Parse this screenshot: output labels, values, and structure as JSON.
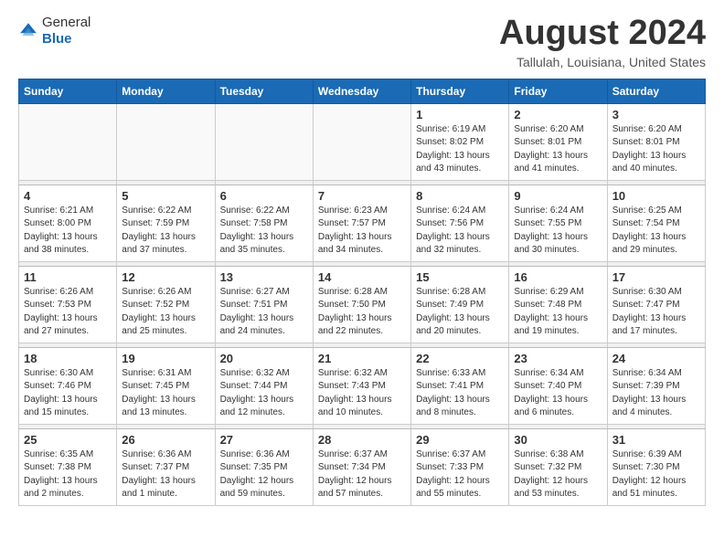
{
  "logo": {
    "general": "General",
    "blue": "Blue"
  },
  "title": "August 2024",
  "location": "Tallulah, Louisiana, United States",
  "weekdays": [
    "Sunday",
    "Monday",
    "Tuesday",
    "Wednesday",
    "Thursday",
    "Friday",
    "Saturday"
  ],
  "weeks": [
    [
      {
        "day": "",
        "info": ""
      },
      {
        "day": "",
        "info": ""
      },
      {
        "day": "",
        "info": ""
      },
      {
        "day": "",
        "info": ""
      },
      {
        "day": "1",
        "info": "Sunrise: 6:19 AM\nSunset: 8:02 PM\nDaylight: 13 hours\nand 43 minutes."
      },
      {
        "day": "2",
        "info": "Sunrise: 6:20 AM\nSunset: 8:01 PM\nDaylight: 13 hours\nand 41 minutes."
      },
      {
        "day": "3",
        "info": "Sunrise: 6:20 AM\nSunset: 8:01 PM\nDaylight: 13 hours\nand 40 minutes."
      }
    ],
    [
      {
        "day": "4",
        "info": "Sunrise: 6:21 AM\nSunset: 8:00 PM\nDaylight: 13 hours\nand 38 minutes."
      },
      {
        "day": "5",
        "info": "Sunrise: 6:22 AM\nSunset: 7:59 PM\nDaylight: 13 hours\nand 37 minutes."
      },
      {
        "day": "6",
        "info": "Sunrise: 6:22 AM\nSunset: 7:58 PM\nDaylight: 13 hours\nand 35 minutes."
      },
      {
        "day": "7",
        "info": "Sunrise: 6:23 AM\nSunset: 7:57 PM\nDaylight: 13 hours\nand 34 minutes."
      },
      {
        "day": "8",
        "info": "Sunrise: 6:24 AM\nSunset: 7:56 PM\nDaylight: 13 hours\nand 32 minutes."
      },
      {
        "day": "9",
        "info": "Sunrise: 6:24 AM\nSunset: 7:55 PM\nDaylight: 13 hours\nand 30 minutes."
      },
      {
        "day": "10",
        "info": "Sunrise: 6:25 AM\nSunset: 7:54 PM\nDaylight: 13 hours\nand 29 minutes."
      }
    ],
    [
      {
        "day": "11",
        "info": "Sunrise: 6:26 AM\nSunset: 7:53 PM\nDaylight: 13 hours\nand 27 minutes."
      },
      {
        "day": "12",
        "info": "Sunrise: 6:26 AM\nSunset: 7:52 PM\nDaylight: 13 hours\nand 25 minutes."
      },
      {
        "day": "13",
        "info": "Sunrise: 6:27 AM\nSunset: 7:51 PM\nDaylight: 13 hours\nand 24 minutes."
      },
      {
        "day": "14",
        "info": "Sunrise: 6:28 AM\nSunset: 7:50 PM\nDaylight: 13 hours\nand 22 minutes."
      },
      {
        "day": "15",
        "info": "Sunrise: 6:28 AM\nSunset: 7:49 PM\nDaylight: 13 hours\nand 20 minutes."
      },
      {
        "day": "16",
        "info": "Sunrise: 6:29 AM\nSunset: 7:48 PM\nDaylight: 13 hours\nand 19 minutes."
      },
      {
        "day": "17",
        "info": "Sunrise: 6:30 AM\nSunset: 7:47 PM\nDaylight: 13 hours\nand 17 minutes."
      }
    ],
    [
      {
        "day": "18",
        "info": "Sunrise: 6:30 AM\nSunset: 7:46 PM\nDaylight: 13 hours\nand 15 minutes."
      },
      {
        "day": "19",
        "info": "Sunrise: 6:31 AM\nSunset: 7:45 PM\nDaylight: 13 hours\nand 13 minutes."
      },
      {
        "day": "20",
        "info": "Sunrise: 6:32 AM\nSunset: 7:44 PM\nDaylight: 13 hours\nand 12 minutes."
      },
      {
        "day": "21",
        "info": "Sunrise: 6:32 AM\nSunset: 7:43 PM\nDaylight: 13 hours\nand 10 minutes."
      },
      {
        "day": "22",
        "info": "Sunrise: 6:33 AM\nSunset: 7:41 PM\nDaylight: 13 hours\nand 8 minutes."
      },
      {
        "day": "23",
        "info": "Sunrise: 6:34 AM\nSunset: 7:40 PM\nDaylight: 13 hours\nand 6 minutes."
      },
      {
        "day": "24",
        "info": "Sunrise: 6:34 AM\nSunset: 7:39 PM\nDaylight: 13 hours\nand 4 minutes."
      }
    ],
    [
      {
        "day": "25",
        "info": "Sunrise: 6:35 AM\nSunset: 7:38 PM\nDaylight: 13 hours\nand 2 minutes."
      },
      {
        "day": "26",
        "info": "Sunrise: 6:36 AM\nSunset: 7:37 PM\nDaylight: 13 hours\nand 1 minute."
      },
      {
        "day": "27",
        "info": "Sunrise: 6:36 AM\nSunset: 7:35 PM\nDaylight: 12 hours\nand 59 minutes."
      },
      {
        "day": "28",
        "info": "Sunrise: 6:37 AM\nSunset: 7:34 PM\nDaylight: 12 hours\nand 57 minutes."
      },
      {
        "day": "29",
        "info": "Sunrise: 6:37 AM\nSunset: 7:33 PM\nDaylight: 12 hours\nand 55 minutes."
      },
      {
        "day": "30",
        "info": "Sunrise: 6:38 AM\nSunset: 7:32 PM\nDaylight: 12 hours\nand 53 minutes."
      },
      {
        "day": "31",
        "info": "Sunrise: 6:39 AM\nSunset: 7:30 PM\nDaylight: 12 hours\nand 51 minutes."
      }
    ]
  ]
}
